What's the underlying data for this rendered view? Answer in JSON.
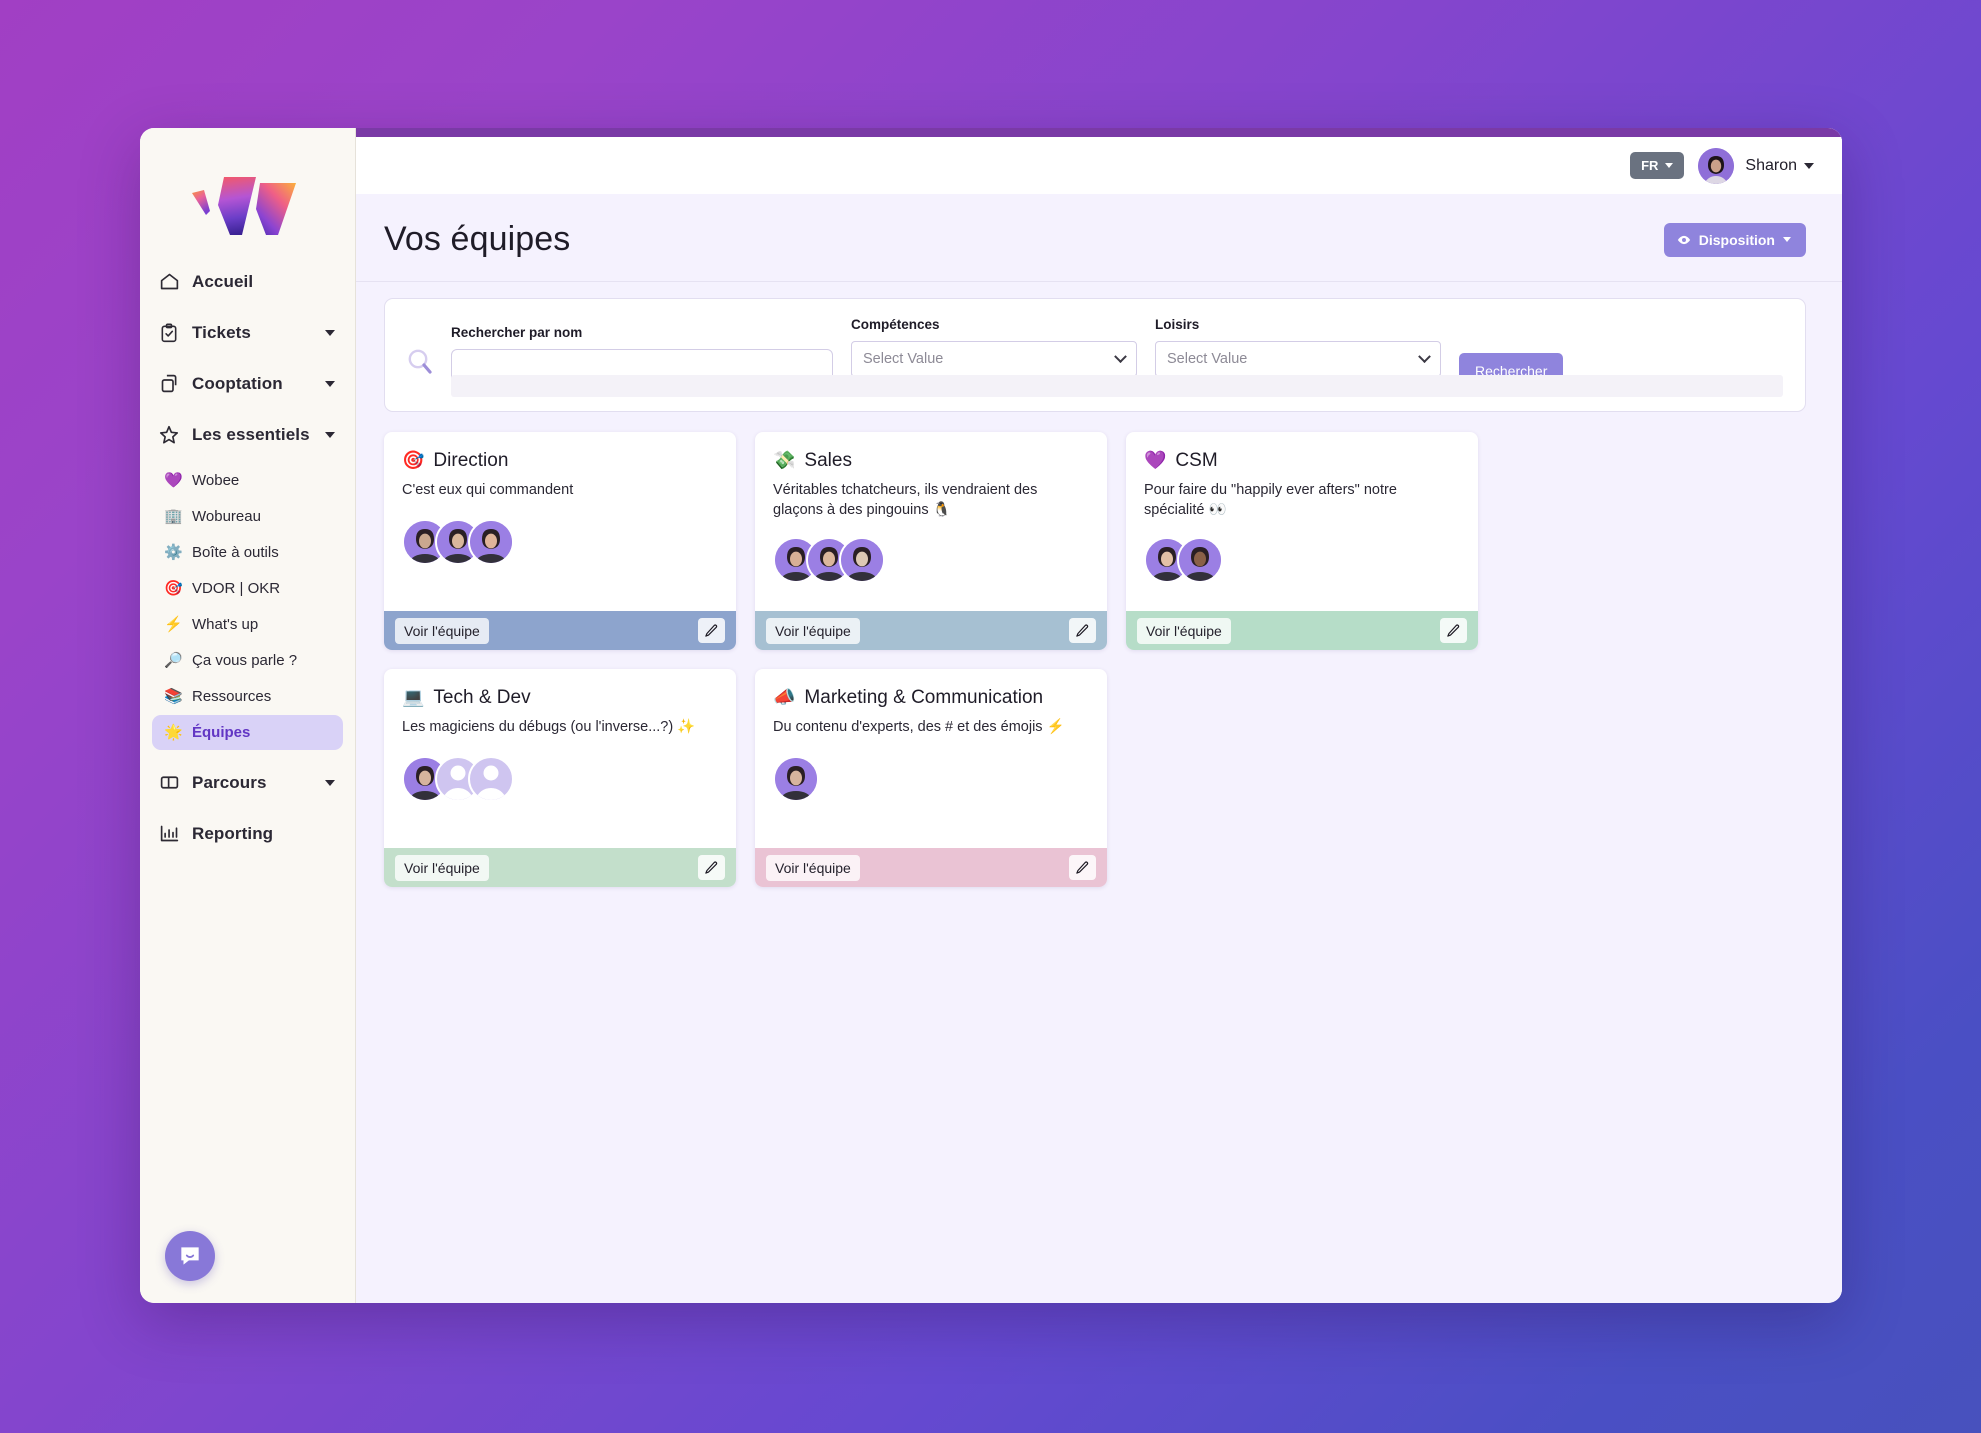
{
  "window": {
    "top_strip_color": "#7a3aa6",
    "sidebar_bg": "#faf8f3",
    "main_bg": "#f5f2fe"
  },
  "brand": {
    "logo_name": "wobee-logo"
  },
  "topbar": {
    "language": "FR",
    "user_name": "Sharon"
  },
  "page": {
    "title": "Vos équipes",
    "disposition_label": "Disposition"
  },
  "search": {
    "name_label": "Rechercher par nom",
    "name_value": "",
    "name_placeholder": "",
    "skills_label": "Compétences",
    "skills_value": "Select Value",
    "hobbies_label": "Loisirs",
    "hobbies_value": "Select Value",
    "submit_label": "Rechercher"
  },
  "sidebar": {
    "items": [
      {
        "label": "Accueil",
        "icon": "home-icon",
        "expandable": false
      },
      {
        "label": "Tickets",
        "icon": "clipboard-icon",
        "expandable": true
      },
      {
        "label": "Cooptation",
        "icon": "copy-icon",
        "expandable": true
      },
      {
        "label": "Les essentiels",
        "icon": "star-outline-icon",
        "expandable": true
      },
      {
        "label": "Parcours",
        "icon": "layout-icon",
        "expandable": true
      },
      {
        "label": "Reporting",
        "icon": "bar-chart-icon",
        "expandable": false
      }
    ],
    "essentials": [
      {
        "label": "Wobee",
        "emoji": "💜",
        "active": false
      },
      {
        "label": "Wobureau",
        "emoji": "🏢",
        "active": false
      },
      {
        "label": "Boîte à outils",
        "emoji": "⚙️",
        "active": false
      },
      {
        "label": "VDOR | OKR",
        "emoji": "🎯",
        "active": false
      },
      {
        "label": "What's up",
        "emoji": "⚡",
        "active": false
      },
      {
        "label": "Ça vous parle ?",
        "emoji": "🔎",
        "active": false
      },
      {
        "label": "Ressources",
        "emoji": "📚",
        "active": false
      },
      {
        "label": "Équipes",
        "emoji": "🌟",
        "active": true
      }
    ],
    "chat_icon": "chat-bubble-icon"
  },
  "teams": [
    {
      "emoji": "🎯",
      "name": "Direction",
      "description": "C'est eux qui commandent",
      "footer_color": "#8da4cd",
      "view_label": "Voir l'équipe",
      "members": [
        {
          "type": "photo",
          "tone": "#caa88f"
        },
        {
          "type": "photo",
          "tone": "#d9b79c"
        },
        {
          "type": "photo",
          "tone": "#e0b49a"
        }
      ]
    },
    {
      "emoji": "💸",
      "name": "Sales",
      "description": "Véritables tchatcheurs, ils vendraient des glaçons à des pingouins 🐧",
      "footer_color": "#a6c0d2",
      "view_label": "Voir l'équipe",
      "members": [
        {
          "type": "photo",
          "tone": "#d8b096"
        },
        {
          "type": "photo",
          "tone": "#dcb79c"
        },
        {
          "type": "photo",
          "tone": "#ddc8b4"
        }
      ]
    },
    {
      "emoji": "💜",
      "name": "CSM",
      "description": "Pour faire du \"happily ever afters\" notre spécialité 👀",
      "footer_color": "#b6ddc8",
      "view_label": "Voir l'équipe",
      "members": [
        {
          "type": "photo",
          "tone": "#e3c0a6"
        },
        {
          "type": "photo",
          "tone": "#8a6048"
        }
      ]
    },
    {
      "emoji": "💻",
      "name": "Tech & Dev",
      "description": "Les magiciens du débugs (ou l'inverse...?) ✨",
      "footer_color": "#c3dfcb",
      "view_label": "Voir l'équipe",
      "members": [
        {
          "type": "photo",
          "tone": "#d6b49d"
        },
        {
          "type": "placeholder"
        },
        {
          "type": "placeholder"
        }
      ]
    },
    {
      "emoji": "📣",
      "name": "Marketing & Communication",
      "description": "Du contenu d'experts, des # et des émojis ⚡",
      "footer_color": "#eac3d4",
      "view_label": "Voir l'équipe",
      "members": [
        {
          "type": "photo",
          "tone": "#d7b49e"
        }
      ]
    }
  ]
}
